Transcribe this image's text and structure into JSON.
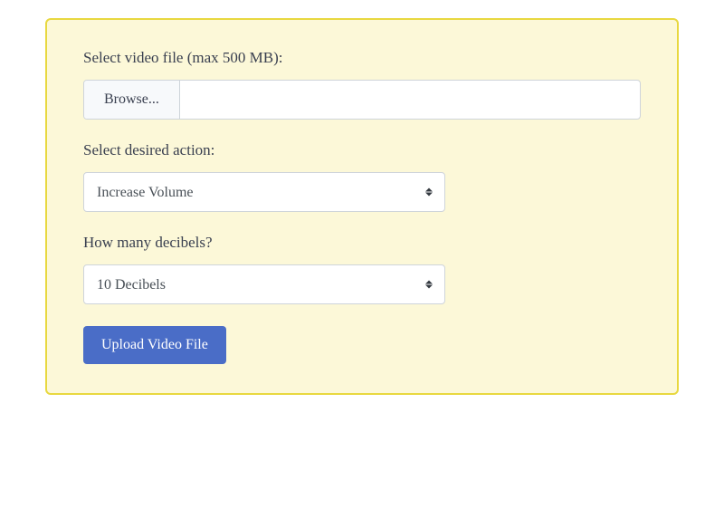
{
  "form": {
    "file": {
      "label": "Select video file (max 500 MB):",
      "browse_button": "Browse...",
      "filename": ""
    },
    "action": {
      "label": "Select desired action:",
      "selected": "Increase Volume"
    },
    "decibels": {
      "label": "How many decibels?",
      "selected": "10 Decibels"
    },
    "submit_label": "Upload Video File"
  }
}
